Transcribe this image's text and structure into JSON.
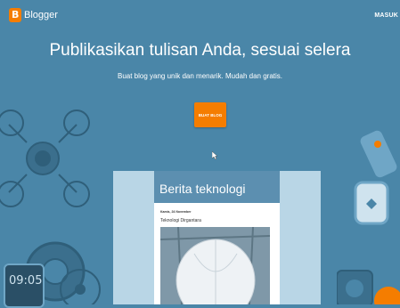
{
  "header": {
    "logo_text": "Blogger",
    "signin_label": "MASUK"
  },
  "hero": {
    "title": "Publikasikan tulisan Anda, sesuai selera",
    "subtitle": "Buat blog yang unik dan menarik. Mudah dan gratis.",
    "cta_label": "BUAT BLOG"
  },
  "preview": {
    "blog_title": "Berita teknologi",
    "post_date": "Kamis, 24 November",
    "post_title": "Teknologi Dirgantara"
  },
  "decor": {
    "watch_time": "09:05"
  },
  "colors": {
    "background": "#4a86a8",
    "accent": "#f57d00",
    "card_header": "#5c8fb0"
  }
}
